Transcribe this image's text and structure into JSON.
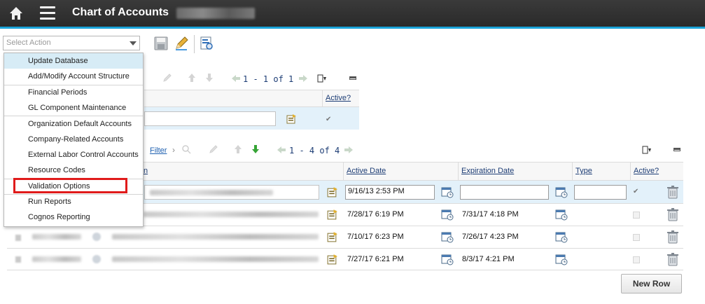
{
  "app": {
    "title": "Chart of Accounts"
  },
  "toolbar": {
    "select_action_placeholder": "Select Action"
  },
  "action_menu": {
    "items": [
      "Update Database",
      "Add/Modify Account Structure",
      "Financial Periods",
      "GL Component Maintenance",
      "Organization Default Accounts",
      "Company-Related Accounts",
      "External Labor Control Accounts",
      "Resource Codes",
      "Validation Options",
      "Run Reports",
      "Cognos Reporting"
    ],
    "highlighted": "Update Database",
    "boxed": "Validation Options"
  },
  "grid1": {
    "pager": "1 - 1 of 1",
    "header_active": "Active?"
  },
  "grid2": {
    "filter_label": "Filter",
    "pager": "1 - 4 of 4",
    "headers": {
      "name_partial": "n",
      "active_date": "Active Date",
      "expiration_date": "Expiration Date",
      "type": "Type",
      "active": "Active?"
    },
    "rows": [
      {
        "active_date": "9/16/13 2:53 PM",
        "expiration_date": "",
        "type": "",
        "active": true
      },
      {
        "active_date": "7/28/17 6:19 PM",
        "expiration_date": "7/31/17 4:18 PM",
        "type": "",
        "active": false
      },
      {
        "active_date": "7/10/17 6:23 PM",
        "expiration_date": "7/26/17 4:23 PM",
        "type": "",
        "active": false
      },
      {
        "active_date": "7/27/17 6:21 PM",
        "expiration_date": "8/3/17 4:21 PM",
        "type": "",
        "active": false
      }
    ]
  },
  "buttons": {
    "new_row": "New Row"
  }
}
